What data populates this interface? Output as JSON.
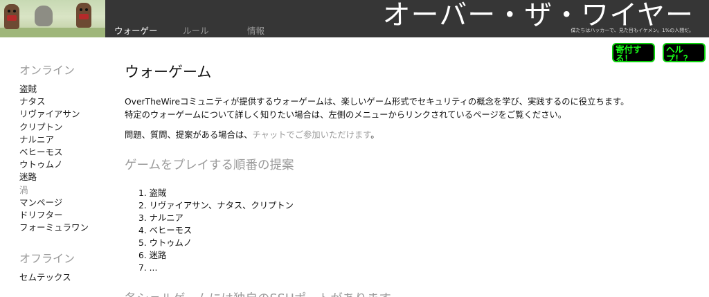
{
  "header": {
    "nav": [
      {
        "label": "ウォーゲー",
        "active": true
      },
      {
        "label": "ルール",
        "active": false
      },
      {
        "label": "情報",
        "active": false
      }
    ],
    "title": "オーバー・ザ・ワイヤー",
    "tagline": "僕たちはハッカーで、見た目もイケメン。1%の人間だ。"
  },
  "floating_buttons": {
    "donate_label": "寄付する！",
    "help_label": "ヘルプ！？",
    "border_color": "#0bd10b",
    "text_color": "#19ff19"
  },
  "sidebar": {
    "online_heading": "オンライン",
    "online_items": [
      "盗賊",
      "ナタス",
      "リヴァイアサン",
      "クリプトン",
      "ナルニア",
      "ベヒーモス",
      "ウトゥムノ",
      "迷路",
      "渦",
      "マンページ",
      "ドリフター",
      "フォーミュラワン"
    ],
    "offline_heading": "オフライン",
    "offline_items": [
      "セムテックス"
    ]
  },
  "main": {
    "title": "ウォーゲーム",
    "intro_line1": "OverTheWireコミュニティが提供するウォーゲームは、楽しいゲーム形式でセキュリティの概念を学び、実践するのに役立ちます。",
    "intro_line2": "特定のウォーゲームについて詳しく知りたい場合は、左側のメニューからリンクされているページをご覧ください。",
    "questions_prefix": "問題、質問、提案がある場合は、",
    "chat_link": "チャットでご参加いただけます",
    "questions_suffix": "。",
    "order_heading": "ゲームをプレイする順番の提案",
    "order_items": [
      "1. 盗賊",
      "2. リヴァイアサン、ナタス、クリプトン",
      "3. ナルニア",
      "4. ベヒーモス",
      "5. ウトゥムノ",
      "6. 迷路",
      "7. ..."
    ],
    "ssh_heading": "各シェルゲームには独自のSSHポートがあります"
  }
}
